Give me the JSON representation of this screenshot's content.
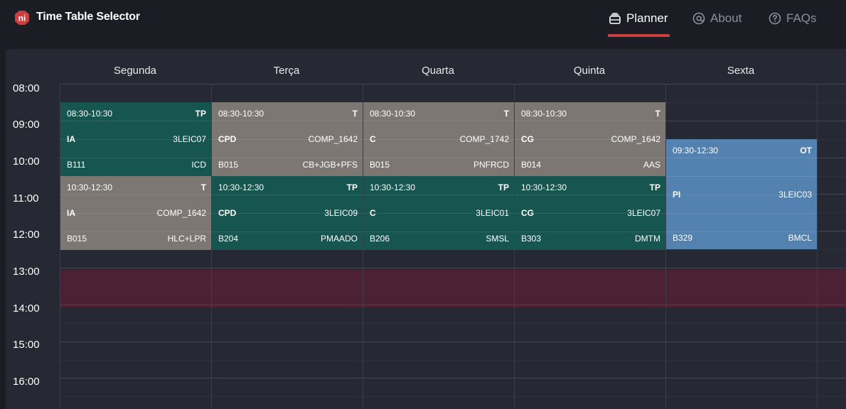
{
  "app": {
    "title": "Time Table Selector",
    "logo_text": "ni"
  },
  "nav": {
    "planner": "Planner",
    "about": "About",
    "faqs": "FAQs",
    "active": "planner"
  },
  "days": [
    "Segunda",
    "Terça",
    "Quarta",
    "Quinta",
    "Sexta"
  ],
  "times": [
    "08:00",
    "09:00",
    "10:00",
    "11:00",
    "12:00",
    "13:00",
    "14:00",
    "15:00",
    "16:00"
  ],
  "colors": {
    "accent": "#c9403f",
    "tp": "#175550",
    "t": "#7d7773",
    "ot": "#5381b0",
    "lunch": "#4b2133"
  },
  "classes": [
    {
      "day": "Segunda",
      "time": "08:30-10:30",
      "type": "TP",
      "course": "IA",
      "group": "3LEIC07",
      "room": "B111",
      "teacher": "ICD"
    },
    {
      "day": "Terça",
      "time": "08:30-10:30",
      "type": "T",
      "course": "CPD",
      "group": "COMP_1642",
      "room": "B015",
      "teacher": "CB+JGB+PFS"
    },
    {
      "day": "Quarta",
      "time": "08:30-10:30",
      "type": "T",
      "course": "C",
      "group": "COMP_1742",
      "room": "B015",
      "teacher": "PNFRCD"
    },
    {
      "day": "Quinta",
      "time": "08:30-10:30",
      "type": "T",
      "course": "CG",
      "group": "COMP_1642",
      "room": "B014",
      "teacher": "AAS"
    },
    {
      "day": "Sexta",
      "time": "09:30-12:30",
      "type": "OT",
      "course": "PI",
      "group": "3LEIC03",
      "room": "B329",
      "teacher": "BMCL"
    },
    {
      "day": "Segunda",
      "time": "10:30-12:30",
      "type": "T",
      "course": "IA",
      "group": "COMP_1642",
      "room": "B015",
      "teacher": "HLC+LPR"
    },
    {
      "day": "Terça",
      "time": "10:30-12:30",
      "type": "TP",
      "course": "CPD",
      "group": "3LEIC09",
      "room": "B204",
      "teacher": "PMAADO"
    },
    {
      "day": "Quarta",
      "time": "10:30-12:30",
      "type": "TP",
      "course": "C",
      "group": "3LEIC01",
      "room": "B206",
      "teacher": "SMSL"
    },
    {
      "day": "Quinta",
      "time": "10:30-12:30",
      "type": "TP",
      "course": "CG",
      "group": "3LEIC07",
      "room": "B303",
      "teacher": "DMTM"
    }
  ]
}
